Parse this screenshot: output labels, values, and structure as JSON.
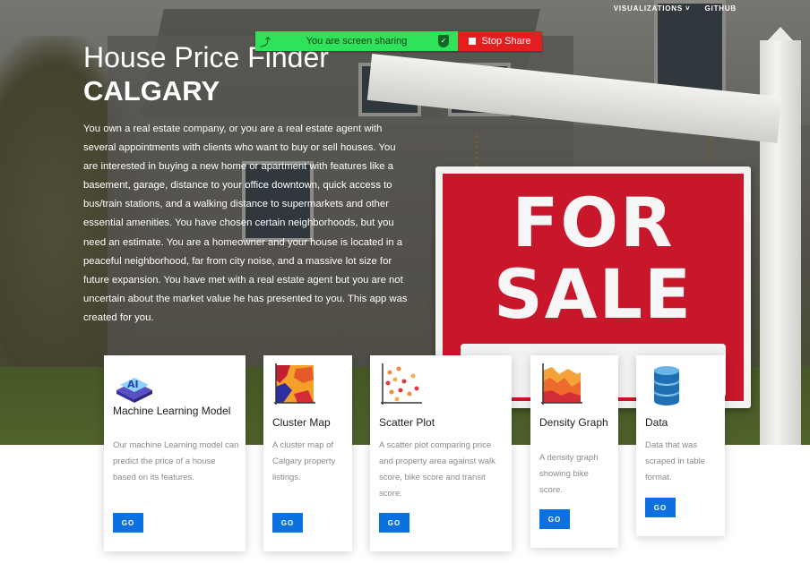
{
  "nav": {
    "items": [
      {
        "label": "VISUALIZATIONS ˅"
      },
      {
        "label": "GITHUB"
      }
    ]
  },
  "screen_share": {
    "message": "You are screen sharing",
    "stop_label": "Stop Share",
    "bar_color": "#2ee35a",
    "stop_color": "#e41e1e"
  },
  "hero": {
    "title_line1": "House Price Finder",
    "title_line2": "CALGARY",
    "intro": "You own a real estate company, or you are a real estate agent with several appointments with clients who want to buy or sell houses. You are interested in buying a new home or apartment with features like a basement, garage, distance to your office downtown, quick access to bus/train stations, and a walking distance to supermarkets and other essential amenities. You have chosen certain neighborhoods, but you need an estimate. You are a homeowner and your house is located in a peaceful neighborhood, far from city noise, and a massive lot size for future expansion. You have met with a real estate agent but you are not uncertain about the market value he has presented to you. This app was created for you.",
    "sign_line1": "FOR",
    "sign_line2": "SALE"
  },
  "cards": [
    {
      "icon": "ai-chip-icon",
      "title": "Machine Learning Model",
      "description": "Our machine Learning model can predict the price of a house based on its features.",
      "button": "GO"
    },
    {
      "icon": "cluster-map-icon",
      "title": "Cluster Map",
      "description": "A cluster map of Calgary property listings.",
      "button": "GO"
    },
    {
      "icon": "scatter-plot-icon",
      "title": "Scatter Plot",
      "description": "A scatter plot comparing price and property area against walk score, bike score and transit score.",
      "button": "GO"
    },
    {
      "icon": "density-graph-icon",
      "title": "Density Graph",
      "description": "A density graph showing bike score.",
      "button": "GO"
    },
    {
      "icon": "database-icon",
      "title": "Data",
      "description": "Data that was scraped in table format.",
      "button": "GO"
    }
  ],
  "colors": {
    "accent": "#0c71e0",
    "sign_red": "#c8162a"
  }
}
